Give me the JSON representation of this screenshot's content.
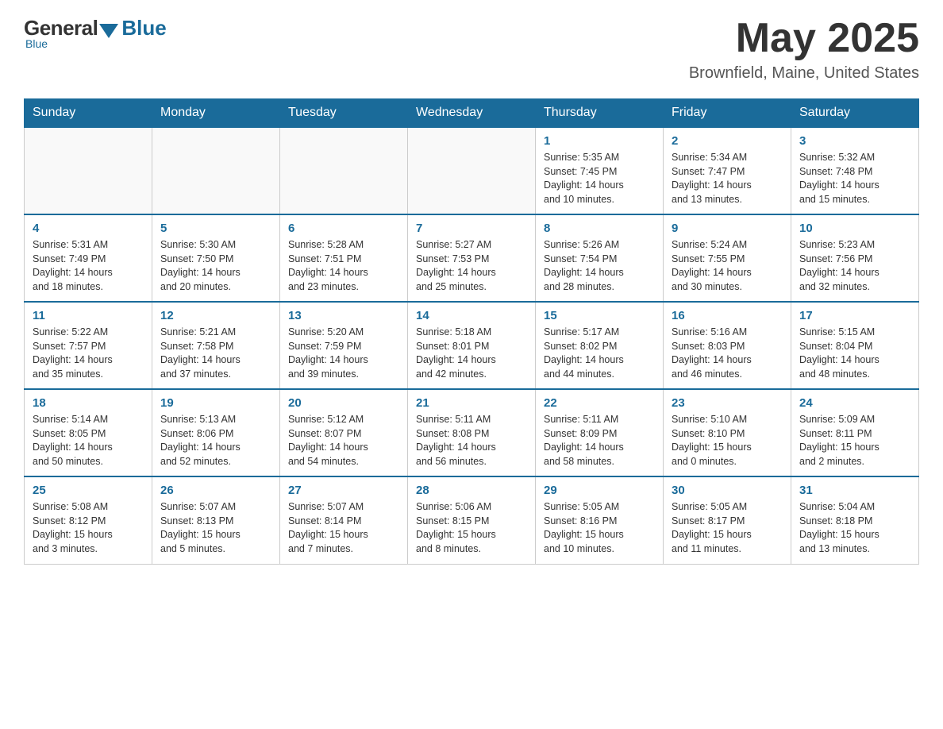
{
  "header": {
    "logo": {
      "general_text": "General",
      "blue_text": "Blue",
      "tagline": "Blue"
    },
    "title": "May 2025",
    "location": "Brownfield, Maine, United States"
  },
  "calendar": {
    "days_of_week": [
      "Sunday",
      "Monday",
      "Tuesday",
      "Wednesday",
      "Thursday",
      "Friday",
      "Saturday"
    ],
    "weeks": [
      [
        {
          "day": "",
          "info": ""
        },
        {
          "day": "",
          "info": ""
        },
        {
          "day": "",
          "info": ""
        },
        {
          "day": "",
          "info": ""
        },
        {
          "day": "1",
          "info": "Sunrise: 5:35 AM\nSunset: 7:45 PM\nDaylight: 14 hours\nand 10 minutes."
        },
        {
          "day": "2",
          "info": "Sunrise: 5:34 AM\nSunset: 7:47 PM\nDaylight: 14 hours\nand 13 minutes."
        },
        {
          "day": "3",
          "info": "Sunrise: 5:32 AM\nSunset: 7:48 PM\nDaylight: 14 hours\nand 15 minutes."
        }
      ],
      [
        {
          "day": "4",
          "info": "Sunrise: 5:31 AM\nSunset: 7:49 PM\nDaylight: 14 hours\nand 18 minutes."
        },
        {
          "day": "5",
          "info": "Sunrise: 5:30 AM\nSunset: 7:50 PM\nDaylight: 14 hours\nand 20 minutes."
        },
        {
          "day": "6",
          "info": "Sunrise: 5:28 AM\nSunset: 7:51 PM\nDaylight: 14 hours\nand 23 minutes."
        },
        {
          "day": "7",
          "info": "Sunrise: 5:27 AM\nSunset: 7:53 PM\nDaylight: 14 hours\nand 25 minutes."
        },
        {
          "day": "8",
          "info": "Sunrise: 5:26 AM\nSunset: 7:54 PM\nDaylight: 14 hours\nand 28 minutes."
        },
        {
          "day": "9",
          "info": "Sunrise: 5:24 AM\nSunset: 7:55 PM\nDaylight: 14 hours\nand 30 minutes."
        },
        {
          "day": "10",
          "info": "Sunrise: 5:23 AM\nSunset: 7:56 PM\nDaylight: 14 hours\nand 32 minutes."
        }
      ],
      [
        {
          "day": "11",
          "info": "Sunrise: 5:22 AM\nSunset: 7:57 PM\nDaylight: 14 hours\nand 35 minutes."
        },
        {
          "day": "12",
          "info": "Sunrise: 5:21 AM\nSunset: 7:58 PM\nDaylight: 14 hours\nand 37 minutes."
        },
        {
          "day": "13",
          "info": "Sunrise: 5:20 AM\nSunset: 7:59 PM\nDaylight: 14 hours\nand 39 minutes."
        },
        {
          "day": "14",
          "info": "Sunrise: 5:18 AM\nSunset: 8:01 PM\nDaylight: 14 hours\nand 42 minutes."
        },
        {
          "day": "15",
          "info": "Sunrise: 5:17 AM\nSunset: 8:02 PM\nDaylight: 14 hours\nand 44 minutes."
        },
        {
          "day": "16",
          "info": "Sunrise: 5:16 AM\nSunset: 8:03 PM\nDaylight: 14 hours\nand 46 minutes."
        },
        {
          "day": "17",
          "info": "Sunrise: 5:15 AM\nSunset: 8:04 PM\nDaylight: 14 hours\nand 48 minutes."
        }
      ],
      [
        {
          "day": "18",
          "info": "Sunrise: 5:14 AM\nSunset: 8:05 PM\nDaylight: 14 hours\nand 50 minutes."
        },
        {
          "day": "19",
          "info": "Sunrise: 5:13 AM\nSunset: 8:06 PM\nDaylight: 14 hours\nand 52 minutes."
        },
        {
          "day": "20",
          "info": "Sunrise: 5:12 AM\nSunset: 8:07 PM\nDaylight: 14 hours\nand 54 minutes."
        },
        {
          "day": "21",
          "info": "Sunrise: 5:11 AM\nSunset: 8:08 PM\nDaylight: 14 hours\nand 56 minutes."
        },
        {
          "day": "22",
          "info": "Sunrise: 5:11 AM\nSunset: 8:09 PM\nDaylight: 14 hours\nand 58 minutes."
        },
        {
          "day": "23",
          "info": "Sunrise: 5:10 AM\nSunset: 8:10 PM\nDaylight: 15 hours\nand 0 minutes."
        },
        {
          "day": "24",
          "info": "Sunrise: 5:09 AM\nSunset: 8:11 PM\nDaylight: 15 hours\nand 2 minutes."
        }
      ],
      [
        {
          "day": "25",
          "info": "Sunrise: 5:08 AM\nSunset: 8:12 PM\nDaylight: 15 hours\nand 3 minutes."
        },
        {
          "day": "26",
          "info": "Sunrise: 5:07 AM\nSunset: 8:13 PM\nDaylight: 15 hours\nand 5 minutes."
        },
        {
          "day": "27",
          "info": "Sunrise: 5:07 AM\nSunset: 8:14 PM\nDaylight: 15 hours\nand 7 minutes."
        },
        {
          "day": "28",
          "info": "Sunrise: 5:06 AM\nSunset: 8:15 PM\nDaylight: 15 hours\nand 8 minutes."
        },
        {
          "day": "29",
          "info": "Sunrise: 5:05 AM\nSunset: 8:16 PM\nDaylight: 15 hours\nand 10 minutes."
        },
        {
          "day": "30",
          "info": "Sunrise: 5:05 AM\nSunset: 8:17 PM\nDaylight: 15 hours\nand 11 minutes."
        },
        {
          "day": "31",
          "info": "Sunrise: 5:04 AM\nSunset: 8:18 PM\nDaylight: 15 hours\nand 13 minutes."
        }
      ]
    ]
  }
}
